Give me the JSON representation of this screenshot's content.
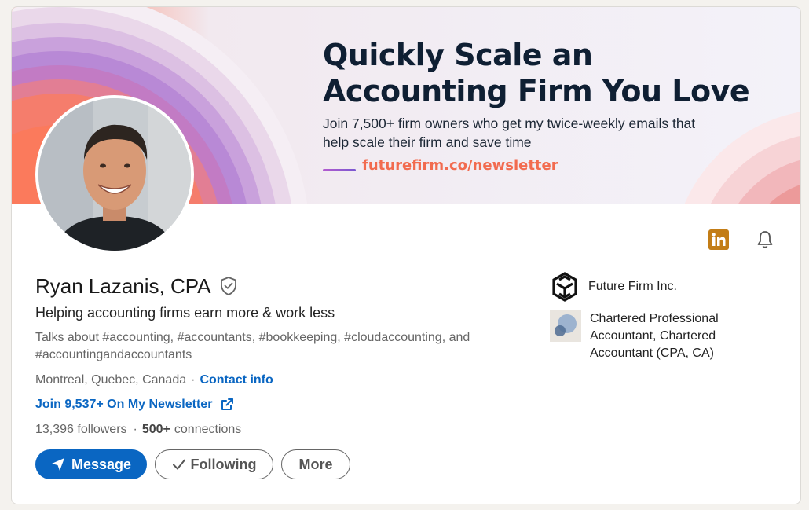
{
  "banner": {
    "headline_line1": "Quickly Scale an",
    "headline_line2": "Accounting Firm You Love",
    "subline_line1": "Join 7,500+ firm owners who get my twice-weekly emails that",
    "subline_line2": "help scale their firm and save time",
    "url": "futurefirm.co/newsletter"
  },
  "profile": {
    "name": "Ryan Lazanis, CPA",
    "headline": "Helping accounting firms earn more & work less",
    "talks_about": "Talks about #accounting, #accountants, #bookkeeping, #cloudaccounting, and #accountingandaccountants",
    "location": "Montreal, Quebec, Canada",
    "location_sep": "·",
    "contact_info": "Contact info",
    "newsletter": "Join 9,537+ On My Newsletter",
    "followers": "13,396 followers",
    "stats_sep": "·",
    "connections_count": "500+",
    "connections_label": "connections"
  },
  "actions": {
    "message": "Message",
    "following": "Following",
    "more": "More"
  },
  "sidebar": {
    "company": "Future Firm Inc.",
    "education": "Chartered Professional Accountant, Chartered Accountant (CPA, CA)"
  },
  "colors": {
    "accent": "#0a66c2",
    "banner_url": "#f26b4f",
    "linkedin_icon": "#c37d16"
  },
  "icons": [
    "linkedin-icon",
    "bell-icon",
    "verified-shield-icon",
    "external-link-icon",
    "send-icon",
    "checkmark-icon"
  ]
}
